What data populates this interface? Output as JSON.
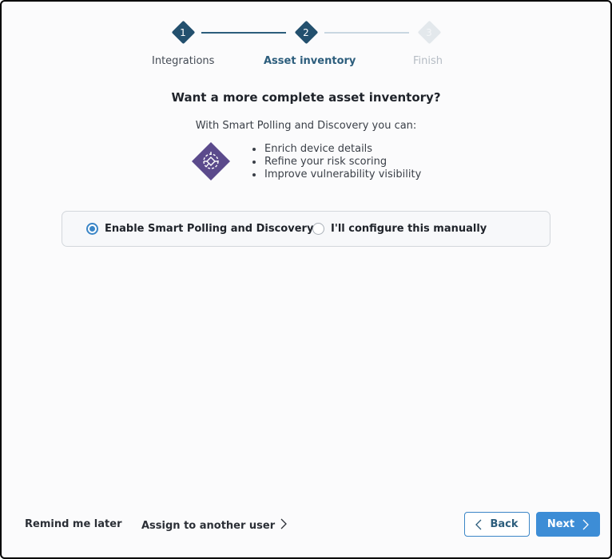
{
  "wizard": {
    "steps": [
      {
        "number": "1",
        "label": "Integrations",
        "state": "done"
      },
      {
        "number": "2",
        "label": "Asset inventory",
        "state": "active"
      },
      {
        "number": "3",
        "label": "Finish",
        "state": "pending"
      }
    ]
  },
  "content": {
    "title": "Want a more complete asset inventory?",
    "subtitle": "With Smart Polling and Discovery you can:",
    "feature_icon": "smart-polling-discovery-icon",
    "benefits": [
      "Enrich device details",
      "Refine your risk scoring",
      "Improve vulnerability visibility"
    ]
  },
  "options": {
    "enable_label": "Enable Smart Polling and Discovery",
    "manual_label": "I'll configure this manually",
    "selected": "enable"
  },
  "footer": {
    "remind_label": "Remind me later",
    "assign_label": "Assign to another user",
    "back_label": "Back",
    "next_label": "Next"
  },
  "colors": {
    "primary": "#3d8dd6",
    "step_done": "#23506e",
    "icon_purple": "#5b4a8c"
  }
}
